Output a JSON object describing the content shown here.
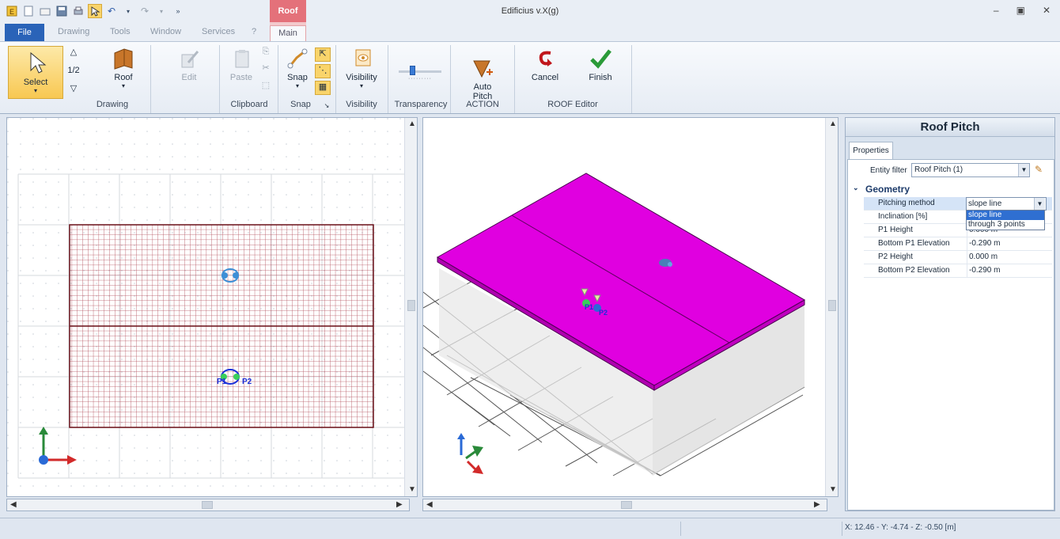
{
  "app": {
    "title": "Edificius v.X(g)",
    "context_tab": "Roof"
  },
  "menu": {
    "file": "File",
    "tabs": [
      "Drawing",
      "Tools",
      "Window",
      "Services",
      "?"
    ],
    "main_tab": "Main"
  },
  "ribbon": {
    "select": "Select",
    "half": "1/2",
    "roof": "Roof",
    "edit": "Edit",
    "paste": "Paste",
    "snap": "Snap",
    "visibility": "Visibility",
    "auto_pitch": "Auto\nPitch",
    "cancel": "Cancel",
    "finish": "Finish",
    "groups": {
      "drawing": "Drawing",
      "clipboard": "Clipboard",
      "snap": "Snap",
      "visibility": "Visibility",
      "transparency": "Transparency",
      "action": "ACTION",
      "roof_editor": "ROOF Editor"
    }
  },
  "plan_view": {
    "p1": "P1",
    "p2": "P2"
  },
  "view3d": {
    "p1": "P1",
    "p2": "P2",
    "roof_color": "#e000e0"
  },
  "properties": {
    "title": "Roof Pitch",
    "tab": "Properties",
    "entity_filter_label": "Entity filter",
    "entity_filter_value": "Roof Pitch (1)",
    "section": "Geometry",
    "rows": [
      {
        "key": "Pitching method",
        "value": "slope line"
      },
      {
        "key": "Inclination  [%]",
        "value": ""
      },
      {
        "key": "P1 Height",
        "value": "0.000 m"
      },
      {
        "key": "Bottom P1 Elevation",
        "value": "-0.290 m"
      },
      {
        "key": "P2 Height",
        "value": "0.000 m"
      },
      {
        "key": "Bottom P2 Elevation",
        "value": "-0.290 m"
      }
    ],
    "dropdown": {
      "selected": "slope line",
      "options": [
        "slope line",
        "through 3 points"
      ]
    }
  },
  "status": {
    "coords": "X: 12.46 - Y: -4.74 - Z: -0.50 [m]"
  }
}
